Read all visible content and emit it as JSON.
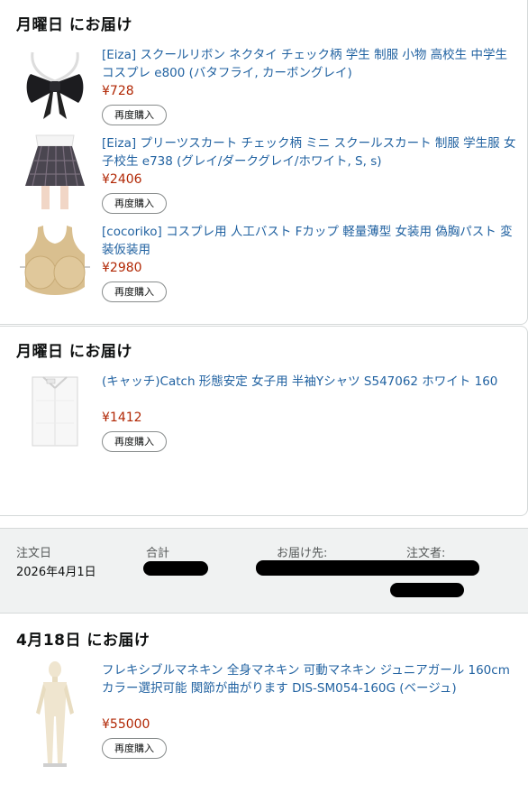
{
  "groups": [
    {
      "delivery": "月曜日 にお届け",
      "items": [
        {
          "title": "[Eiza] スクールリボン ネクタイ チェック柄 学生 制服 小物 高校生 中学生 コスプレ e800 (バタフライ, カーボングレイ)",
          "price": "¥728",
          "button": "再度購入",
          "icon": "bow-tie-icon"
        },
        {
          "title": "[Eiza] プリーツスカート チェック柄 ミニ スクールスカート 制服 学生服 女子校生 e738 (グレイ/ダークグレイ/ホワイト, S, s)",
          "price": "¥2406",
          "button": "再度購入",
          "icon": "skirt-icon"
        },
        {
          "title": "[cocoriko] コスプレ用 人工バスト Fカップ 軽量薄型 女装用 偽胸パスト 変装仮装用",
          "price": "¥2980",
          "button": "再度購入",
          "icon": "breast-form-icon"
        }
      ]
    },
    {
      "delivery": "月曜日 にお届け",
      "items": [
        {
          "title": "(キャッチ)Catch 形態安定 女子用 半袖Yシャツ S547062 ホワイト 160",
          "price": "¥1412",
          "button": "再度購入",
          "icon": "shirt-icon"
        }
      ]
    },
    {
      "delivery": "4月18日 にお届け",
      "items": [
        {
          "title": "フレキシブルマネキン 全身マネキン 可動マネキン ジュニアガール 160cm カラー選択可能 関節が曲がります DIS-SM054-160G (ベージュ)",
          "price": "¥55000",
          "button": "再度購入",
          "icon": "mannequin-icon"
        }
      ]
    }
  ],
  "order": {
    "date_label": "注文日",
    "date_value": "2026年4月1日",
    "total_label": "合計",
    "ship_to_label": "お届け先:",
    "orderer_label": "注文者:"
  },
  "colors": {
    "link": "#2162a1",
    "price": "#b12704",
    "header_bg": "#f0f2f2"
  }
}
